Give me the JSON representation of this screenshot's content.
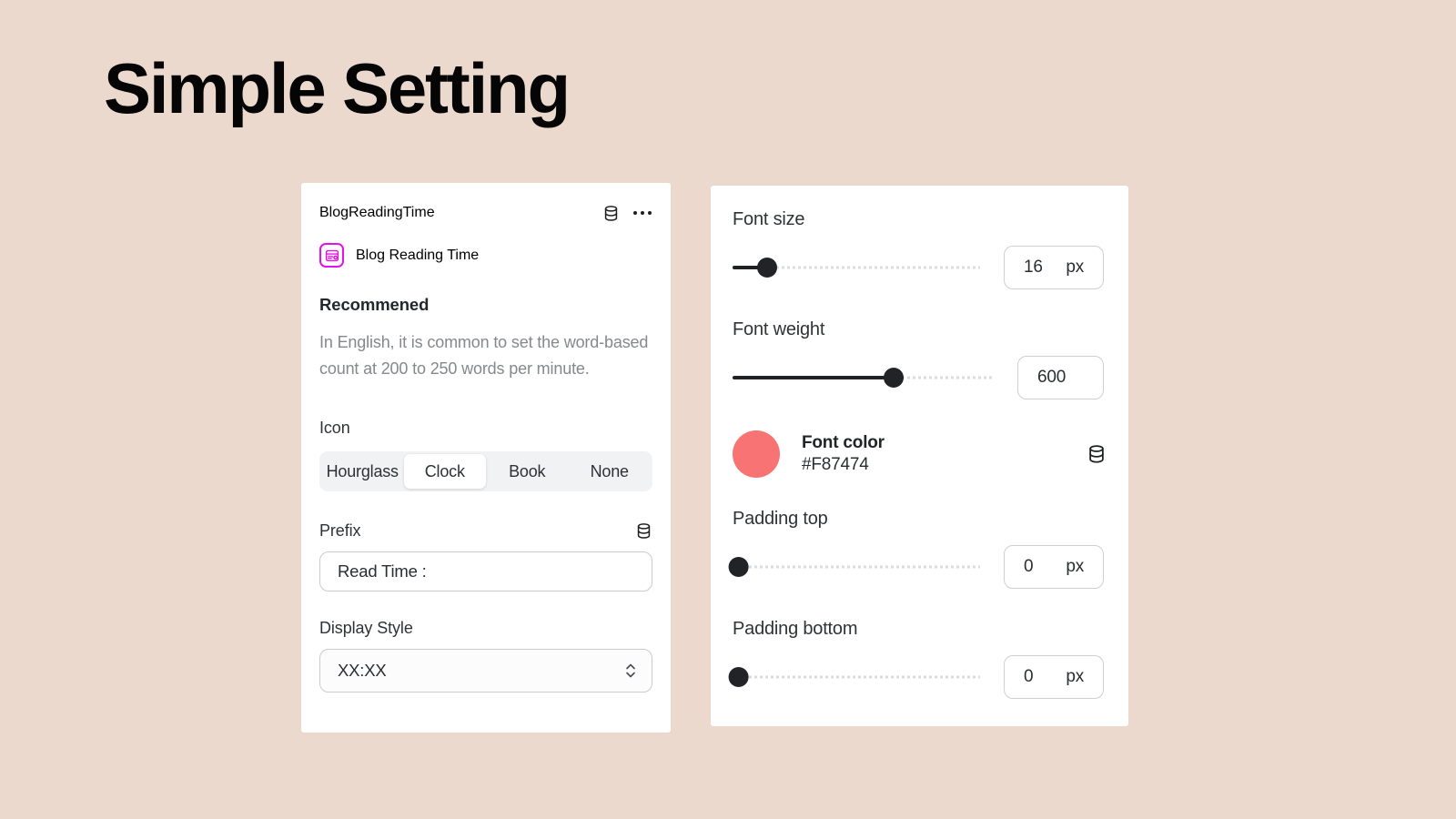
{
  "page": {
    "title": "Simple Setting",
    "background_color": "#EBD9CE"
  },
  "left_panel": {
    "title": "BlogReadingTime",
    "header_icons": {
      "database": "database-icon",
      "more": "more-options-icon"
    },
    "badge_icon": "blog-card-icon",
    "subtitle": "Blog Reading Time",
    "recommended_heading": "Recommened",
    "recommended_text": "In English, it is common to set the word-based count at 200 to 250 words per minute.",
    "icon_field": {
      "label": "Icon",
      "options": [
        "Hourglass",
        "Clock",
        "Book",
        "None"
      ],
      "selected": "Clock"
    },
    "prefix_field": {
      "label": "Prefix",
      "value": "Read Time :",
      "placeholder": "Read Time :",
      "database_icon": "database-icon"
    },
    "display_style_field": {
      "label": "Display Style",
      "value": "XX:XX",
      "chevron_icon": "chevron-updown-icon"
    }
  },
  "right_panel": {
    "font_size": {
      "label": "Font size",
      "value": "16",
      "unit": "px",
      "percent": 14
    },
    "font_weight": {
      "label": "Font weight",
      "value": "600",
      "unit": "",
      "percent": 62
    },
    "font_color": {
      "label": "Font color",
      "hex": "#F87474",
      "swatch_color": "#F87474",
      "database_icon": "database-icon"
    },
    "padding_top": {
      "label": "Padding top",
      "value": "0",
      "unit": "px",
      "percent": 0
    },
    "padding_bottom": {
      "label": "Padding bottom",
      "value": "0",
      "unit": "px",
      "percent": 0
    }
  }
}
